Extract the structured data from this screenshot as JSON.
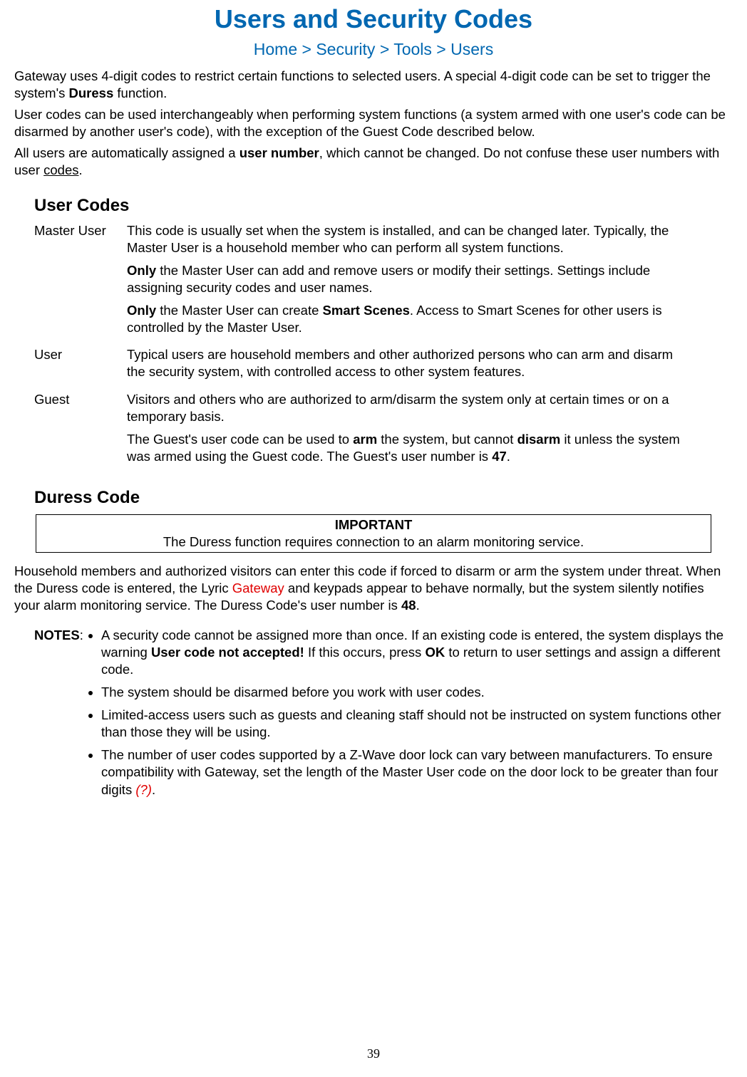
{
  "title": "Users and Security Codes",
  "breadcrumb": "Home > Security > Tools > Users",
  "intro": {
    "p1a": "Gateway uses 4-digit codes to restrict certain functions to selected users. A special 4-digit code can be set to trigger the system's ",
    "p1b": "Duress",
    "p1c": " function.",
    "p2": "User codes can be used interchangeably when performing system functions (a system armed with one user's code can be disarmed by another user's code), with the exception of the Guest Code described below.",
    "p3a": "All users are automatically assigned a ",
    "p3b": "user number",
    "p3c": ", which cannot be changed. Do not confuse these user numbers with user ",
    "p3d": "codes",
    "p3e": "."
  },
  "user_codes": {
    "heading": "User Codes",
    "master": {
      "term": "Master User",
      "d1": "This code is usually set when the system is installed, and can be changed later.  Typically, the Master User is a household member who can perform all system functions.",
      "d2a": "Only",
      "d2b": " the Master User can add and remove users or modify their settings. Settings include assigning security codes and user names.",
      "d3a": "Only",
      "d3b": " the Master User can create ",
      "d3c": "Smart Scenes",
      "d3d": ". Access to Smart Scenes for other users is controlled by the Master User."
    },
    "user": {
      "term": "User",
      "d1": "Typical users are household members and other authorized persons who can arm and disarm the security system, with controlled access to other system features."
    },
    "guest": {
      "term": "Guest",
      "d1": "Visitors and others who are authorized to arm/disarm the system only at certain times or on a temporary basis.",
      "d2a": "The Guest's user code can be used to ",
      "d2b": "arm",
      "d2c": " the system, but cannot ",
      "d2d": "disarm",
      "d2e": " it unless the system was armed using the Guest code.  The Guest's user number is ",
      "d2f": "47",
      "d2g": "."
    }
  },
  "duress": {
    "heading": "Duress Code",
    "imp_head": "IMPORTANT",
    "imp_body": "The Duress function requires connection to an alarm monitoring service.",
    "p1a": "Household members and authorized visitors can enter this code if forced to disarm or arm the system under threat. When the Duress code is entered, the Lyric ",
    "p1b": "Gateway",
    "p1c": " and keypads appear to behave normally, but the system silently notifies your alarm monitoring service. The Duress Code's user number is ",
    "p1d": "48",
    "p1e": "."
  },
  "notes": {
    "label": "NOTES",
    "colon": ":",
    "n1a": "A security code cannot be assigned more than once. If an existing code is entered, the system displays the warning ",
    "n1b": "User code not accepted!",
    "n1c": " If this occurs, press ",
    "n1d": "OK",
    "n1e": " to return to user settings and assign a different code.",
    "n2": "The system should be disarmed before you work with user codes.",
    "n3": "Limited-access users such as guests and cleaning staff should not be instructed on system functions other than those they will be using.",
    "n4a": "The number of user codes supported by a Z-Wave door lock can vary between manufacturers. To ensure compatibility with Gateway, set the length of the Master User code on the door lock to be greater than four digits ",
    "n4b": "(?)",
    "n4c": "."
  },
  "page_number": "39"
}
